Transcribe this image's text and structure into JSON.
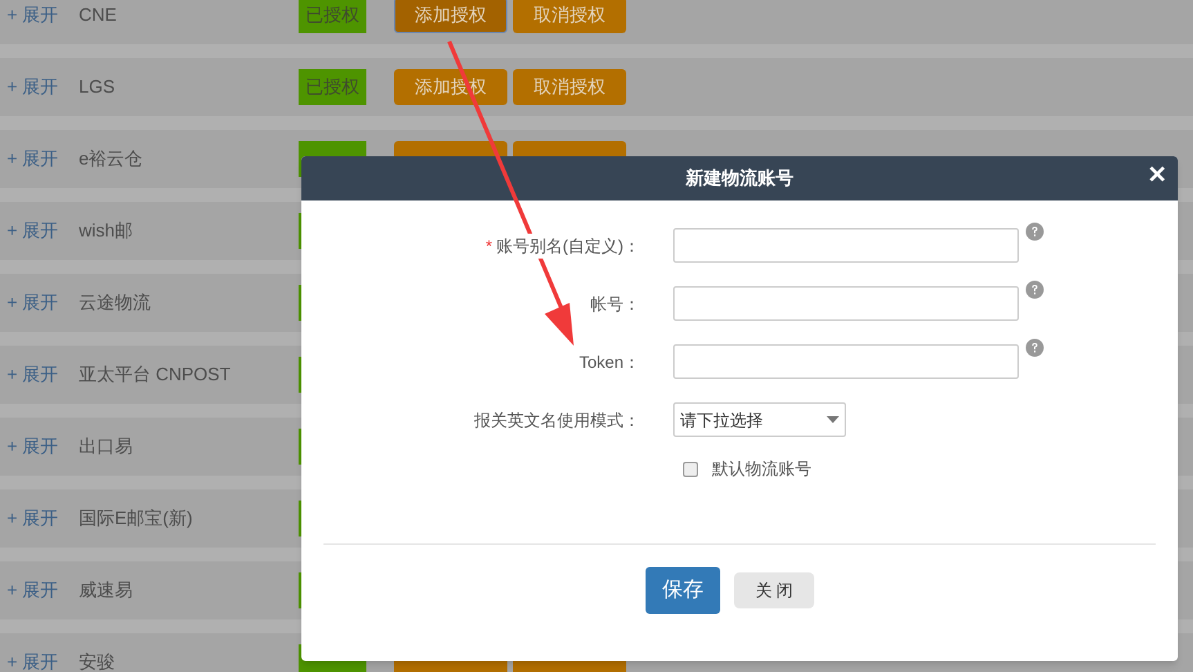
{
  "rows": [
    {
      "expand": "+ 展开",
      "name": "CNE",
      "status": "已授权",
      "buttons": [
        {
          "label": "添加授权",
          "focused": true
        },
        {
          "label": "取消授权",
          "focused": false
        }
      ]
    },
    {
      "expand": "+ 展开",
      "name": "LGS",
      "status": "已授权",
      "buttons": [
        {
          "label": "添加授权",
          "focused": false
        },
        {
          "label": "取消授权",
          "focused": false
        }
      ]
    },
    {
      "expand": "+ 展开",
      "name": "e裕云仓",
      "kind": "partial"
    },
    {
      "expand": "+ 展开",
      "name": "wish邮"
    },
    {
      "expand": "+ 展开",
      "name": "云途物流"
    },
    {
      "expand": "+ 展开",
      "name": "亚太平台 CNPOST"
    },
    {
      "expand": "+ 展开",
      "name": "出口易"
    },
    {
      "expand": "+ 展开",
      "name": "国际E邮宝(新)"
    },
    {
      "expand": "+ 展开",
      "name": "威速易"
    },
    {
      "expand": "+ 展开",
      "name": "安骏",
      "kind": "partial"
    }
  ],
  "dialog": {
    "title": "新建物流账号",
    "close": "✕",
    "fields": [
      {
        "kind": "text",
        "marker": "*",
        "label": "账号别名(自定义)：",
        "help": true
      },
      {
        "kind": "text",
        "label": "帐号：",
        "help": true
      },
      {
        "kind": "text",
        "label": "Token：",
        "help": true
      },
      {
        "kind": "select",
        "label": "报关英文名使用模式：",
        "value": "请下拉选择",
        "help": false
      }
    ],
    "checkbox": {
      "label": "默认物流账号",
      "checked": false
    },
    "buttons": [
      {
        "kind": "primary",
        "label": "保存"
      },
      {
        "kind": "default",
        "label": "关 闭"
      }
    ]
  }
}
